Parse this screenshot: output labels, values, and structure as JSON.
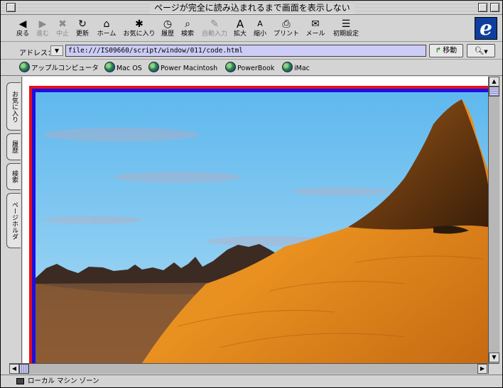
{
  "window": {
    "title": "ページが完全に読み込まれるまで画面を表示しない"
  },
  "toolbar": {
    "buttons": [
      {
        "label": "戻る",
        "icon": "back-arrow-icon",
        "glyph": "◀",
        "enabled": true
      },
      {
        "label": "進む",
        "icon": "forward-arrow-icon",
        "glyph": "▶",
        "enabled": false
      },
      {
        "label": "中止",
        "icon": "stop-icon",
        "glyph": "✖",
        "enabled": false
      },
      {
        "label": "更新",
        "icon": "refresh-icon",
        "glyph": "↻",
        "enabled": true
      },
      {
        "label": "ホーム",
        "icon": "home-icon",
        "glyph": "⌂",
        "enabled": true
      },
      {
        "label": "お気に入り",
        "icon": "favorites-icon",
        "glyph": "✱",
        "enabled": true
      },
      {
        "label": "履歴",
        "icon": "history-clock-icon",
        "glyph": "◷",
        "enabled": true
      },
      {
        "label": "検索",
        "icon": "search-icon",
        "glyph": "⌕",
        "enabled": true
      },
      {
        "label": "自動入力",
        "icon": "autofill-icon",
        "glyph": "✎",
        "enabled": false
      },
      {
        "label": "拡大",
        "icon": "text-larger-icon",
        "glyph": "A",
        "enabled": true
      },
      {
        "label": "縮小",
        "icon": "text-smaller-icon",
        "glyph": "A",
        "enabled": true
      },
      {
        "label": "プリント",
        "icon": "print-icon",
        "glyph": "⎙",
        "enabled": true
      },
      {
        "label": "メール",
        "icon": "mail-icon",
        "glyph": "✉",
        "enabled": true
      },
      {
        "label": "初期設定",
        "icon": "preferences-icon",
        "glyph": "☰",
        "enabled": true
      }
    ]
  },
  "address": {
    "label": "アドレス：",
    "url": "file:///IS09660/script/window/011/code.html",
    "go_label": "移動"
  },
  "favorites": {
    "items": [
      "アップルコンピュータ",
      "Mac OS",
      "Power Macintosh",
      "PowerBook",
      "iMac"
    ]
  },
  "sidetabs": [
    "お気に入り",
    "履歴",
    "検索",
    "ページホルダ"
  ],
  "status": {
    "zone": "ローカル マシン ゾーン"
  },
  "colors": {
    "frame_outer": "#e8101a",
    "frame_inner": "#1a10e0",
    "address_field": "#ccccf6",
    "sky_top": "#6fc0f0",
    "terrain": "#e08a1e"
  }
}
